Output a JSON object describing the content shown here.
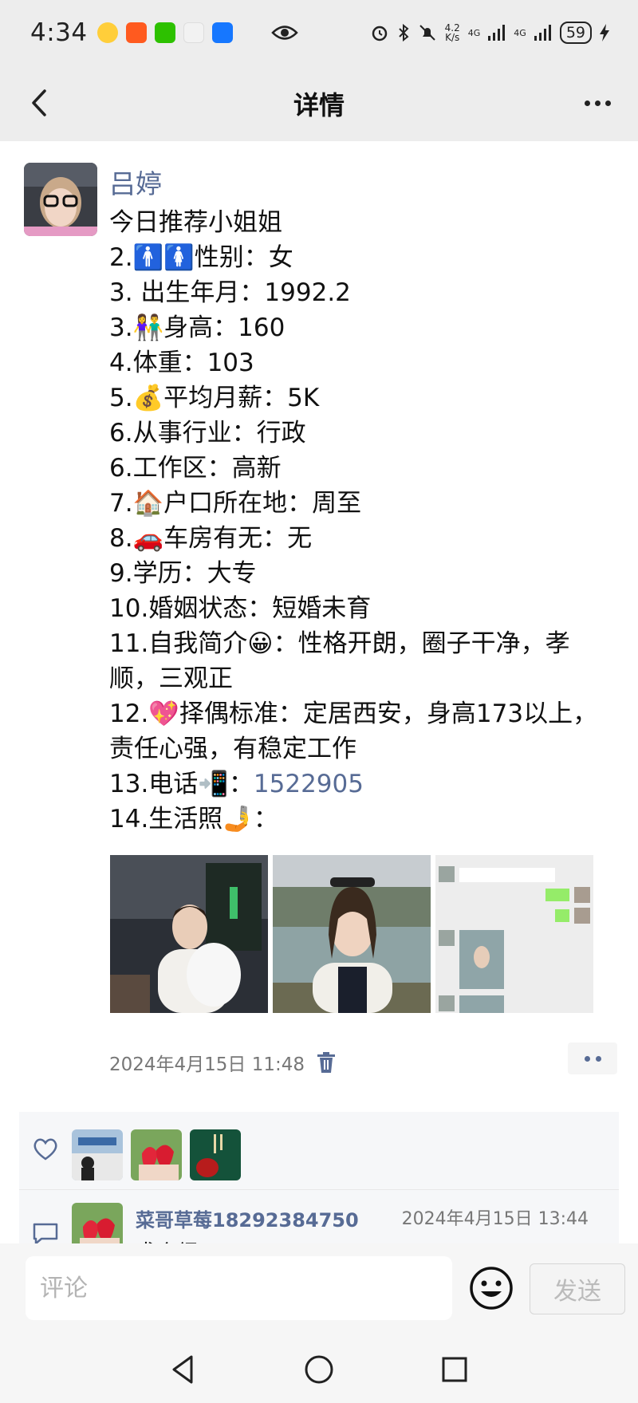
{
  "status_bar": {
    "time": "4:34",
    "net_speed_top": "4.2",
    "net_speed_bottom": "K/s",
    "signal1": "4G",
    "signal2": "4G",
    "battery": "59",
    "app_icons": [
      "weibo-icon",
      "taobao-icon",
      "wechat-icon",
      "app-icon",
      "alipay-icon"
    ]
  },
  "nav": {
    "title": "详情"
  },
  "post": {
    "author": "吕婷",
    "lines": [
      "今日推荐小姐姐",
      "2.🚹🚺性别：女",
      "3. 出生年月：1992.2",
      "3.👫身高：160",
      "4.体重：103",
      "5.💰平均月薪：5K",
      "6.从事行业：行政",
      "6.工作区：高新",
      "7.🏠户口所在地：周至",
      "8.🚗车房有无：无",
      "9.学历：大专",
      "10.婚姻状态：短婚未育"
    ],
    "intro": "11.自我简介😀：性格开朗，圈子干净，孝顺，三观正",
    "criteria": "12.💖择偶标准：定居西安，身高173以上，责任心强，有稳定工作",
    "phone_label": "13.电话📲：",
    "phone_number": "1522905",
    "photos_label": "14.生活照🤳：",
    "timestamp": "2024年4月15日 11:48"
  },
  "social": {
    "comment": {
      "user": "菜哥草莓18292384750",
      "time": "2024年4月15日 13:44",
      "text": "求介绍"
    }
  },
  "input_bar": {
    "placeholder": "评论",
    "send_label": "发送"
  },
  "colors": {
    "link_blue": "#576b95",
    "bar_gray": "#ededed"
  }
}
